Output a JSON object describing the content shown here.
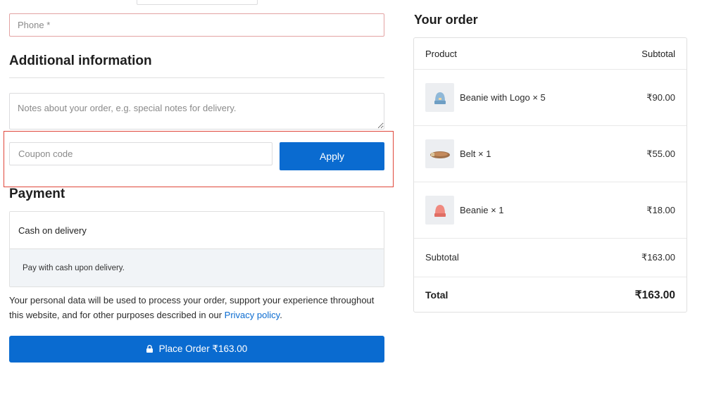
{
  "billing": {
    "phone_placeholder": "Phone *"
  },
  "additional": {
    "title": "Additional information",
    "notes_placeholder": "Notes about your order, e.g. special notes for delivery."
  },
  "coupon": {
    "placeholder": "Coupon code",
    "apply_label": "Apply"
  },
  "payment": {
    "title": "Payment",
    "method_label": "Cash on delivery",
    "method_description": "Pay with cash upon delivery."
  },
  "privacy": {
    "text": "Your personal data will be used to process your order, support your experience throughout this website, and for other purposes described in our ",
    "link_label": "Privacy policy",
    "suffix": "."
  },
  "place_order": {
    "label": "Place Order ₹163.00"
  },
  "order": {
    "title": "Your order",
    "col_product": "Product",
    "col_subtotal": "Subtotal",
    "items": [
      {
        "name": "Beanie with Logo × 5",
        "price": "₹90.00",
        "icon": "beanie-with-logo-thumbnail"
      },
      {
        "name": "Belt × 1",
        "price": "₹55.00",
        "icon": "belt-thumbnail"
      },
      {
        "name": "Beanie × 1",
        "price": "₹18.00",
        "icon": "beanie-thumbnail"
      }
    ],
    "subtotal_label": "Subtotal",
    "subtotal_value": "₹163.00",
    "total_label": "Total",
    "total_value": "₹163.00"
  },
  "colors": {
    "accent": "#0a6bd0",
    "highlight_border": "#e0473b",
    "error_border": "#e3a3a3"
  }
}
